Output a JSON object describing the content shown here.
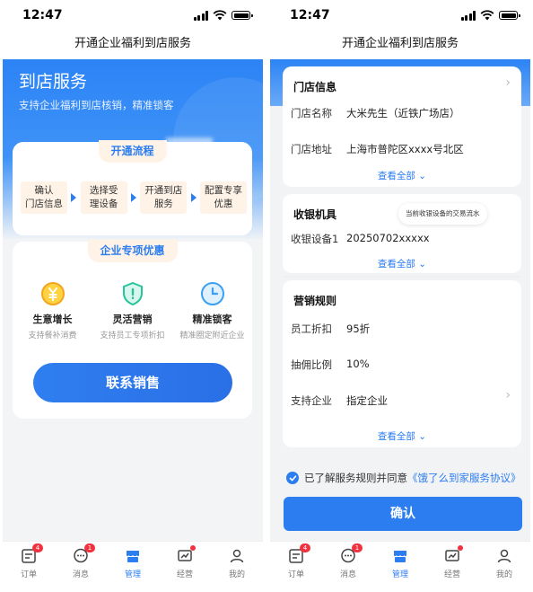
{
  "status_time": "12:47",
  "nav_title": "开通企业福利到店服务",
  "left": {
    "hero": {
      "title": "到店服务",
      "subtitle": "支持企业福利到店核销，精准锁客"
    },
    "flow": {
      "title": "开通流程",
      "steps": [
        "确认\n门店信息",
        "选择受\n理设备",
        "开通到店\n服务",
        "配置专享\n优惠"
      ]
    },
    "promo": {
      "title": "企业专项优惠",
      "features": [
        {
          "icon": "yen-coin-icon",
          "title": "生意增长",
          "subtitle": "支持餐补消费"
        },
        {
          "icon": "shield-icon",
          "title": "灵活营销",
          "subtitle": "支持员工专项折扣"
        },
        {
          "icon": "clock-icon",
          "title": "精准锁客",
          "subtitle": "精准圈定附近企业"
        }
      ],
      "cta_label": "联系销售"
    }
  },
  "right": {
    "store": {
      "title": "门店信息",
      "rows": [
        {
          "key": "门店名称",
          "value": "大米先生（近铁广场店）"
        },
        {
          "key": "门店地址",
          "value": "上海市普陀区xxxx号北区"
        }
      ],
      "more": "查看全部"
    },
    "pos": {
      "title": "收银机具",
      "tooltip": "当前收银设备的交易流水",
      "rows": [
        {
          "key": "收银设备1",
          "value": "20250702xxxxx"
        }
      ],
      "more": "查看全部"
    },
    "rules": {
      "title": "营销规则",
      "rows": [
        {
          "key": "员工折扣",
          "value": "95折"
        },
        {
          "key": "抽佣比例",
          "value": "10%"
        },
        {
          "key": "支持企业",
          "value": "指定企业"
        }
      ],
      "more": "查看全部"
    },
    "agreement": {
      "prefix": "已了解服务规则并同意",
      "link": "《饿了么到家服务协议》"
    },
    "confirm_label": "确认"
  },
  "tabs": [
    {
      "label": "订单",
      "icon": "order-icon",
      "badge": "4"
    },
    {
      "label": "消息",
      "icon": "message-icon",
      "badge": "1"
    },
    {
      "label": "管理",
      "icon": "store-manage-icon",
      "active": true
    },
    {
      "label": "经营",
      "icon": "chart-icon",
      "dot": true
    },
    {
      "label": "我的",
      "icon": "user-icon"
    }
  ],
  "colors": {
    "primary": "#2c7df0",
    "badge": "#f0313e",
    "step_bg": "#fff3e8"
  }
}
